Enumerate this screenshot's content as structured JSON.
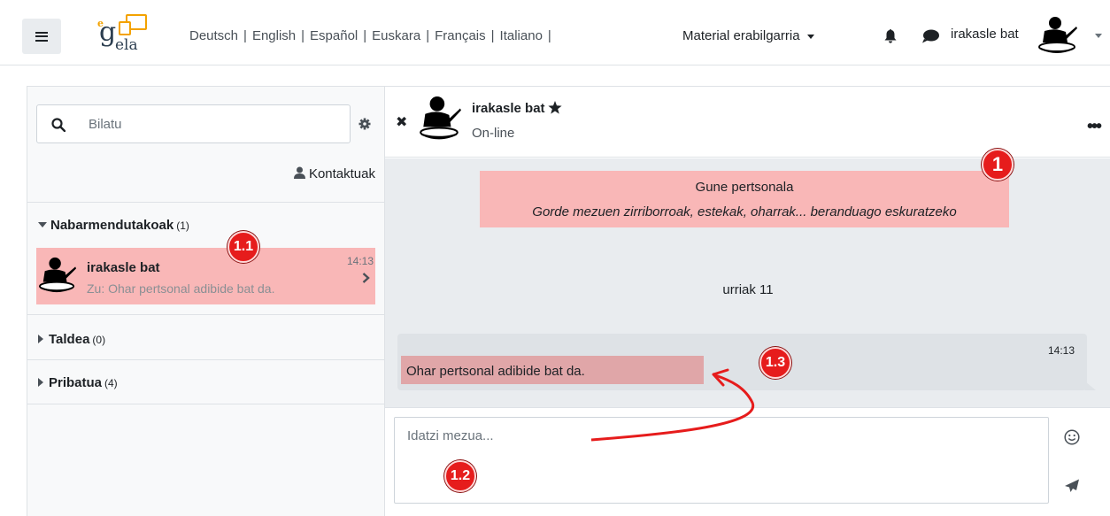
{
  "navbar": {
    "logo_e": "e",
    "logo_g": "g",
    "logo_ela": "ela",
    "languages": [
      "Deutsch",
      "English",
      "Español",
      "Euskara",
      "Français",
      "Italiano"
    ],
    "separator": "|",
    "material_label": "Material erabilgarria",
    "user_name": "irakasle bat"
  },
  "sidebar": {
    "search_placeholder": "Bilatu",
    "contacts_label": "Kontaktuak",
    "sections": [
      {
        "label": "Nabarmendutakoak",
        "count": "(1)"
      },
      {
        "label": "Taldea",
        "count": "(0)"
      },
      {
        "label": "Pribatua",
        "count": "(4)"
      }
    ],
    "conversation": {
      "name": "irakasle bat",
      "time": "14:13",
      "preview_prefix": "Zu:",
      "preview_text": "Ohar pertsonal adibide bat da."
    }
  },
  "conversation": {
    "header_name": "irakasle bat",
    "status": "On-line",
    "more": "•••",
    "close": "✖",
    "self_title": "Gune pertsonala",
    "self_subtitle": "Gorde mezuen zirriborroak, estekak, oharrak... beranduago eskuratzeko",
    "date": "urriak 11",
    "message_time": "14:13",
    "message_text": "Ohar pertsonal adibide bat da.",
    "compose_placeholder": "Idatzi mezua..."
  },
  "callouts": {
    "c1": "1",
    "c11": "1.1",
    "c12": "1.2",
    "c13": "1.3"
  },
  "colors": {
    "highlight": "#f9b7b7",
    "badge": "#e61c1c",
    "arrow": "#e61c1c"
  }
}
